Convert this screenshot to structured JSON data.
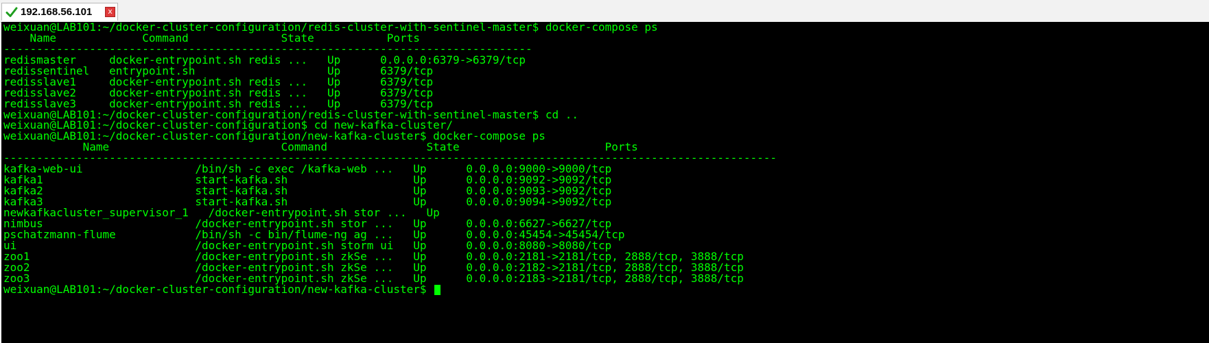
{
  "tab": {
    "title": "192.168.56.101",
    "close_label": "x",
    "status_icon": "checkmark-icon",
    "status_color": "#1e9e1e"
  },
  "terminal": {
    "text_color": "#00ff00",
    "background": "#000000",
    "lines": [
      "weixuan@LAB101:~/docker-cluster-configuration/redis-cluster-with-sentinel-master$ docker-compose ps",
      "    Name             Command              State           Ports",
      "--------------------------------------------------------------------------------",
      "redismaster     docker-entrypoint.sh redis ...   Up      0.0.0.0:6379->6379/tcp",
      "redissentinel   entrypoint.sh                    Up      6379/tcp",
      "redisslave1     docker-entrypoint.sh redis ...   Up      6379/tcp",
      "redisslave2     docker-entrypoint.sh redis ...   Up      6379/tcp",
      "redisslave3     docker-entrypoint.sh redis ...   Up      6379/tcp",
      "weixuan@LAB101:~/docker-cluster-configuration/redis-cluster-with-sentinel-master$ cd ..",
      "weixuan@LAB101:~/docker-cluster-configuration$ cd new-kafka-cluster/",
      "weixuan@LAB101:~/docker-cluster-configuration/new-kafka-cluster$ docker-compose ps",
      "            Name                          Command               State                      Ports",
      "---------------------------------------------------------------------------------------------------------------------",
      "kafka-web-ui                 /bin/sh -c exec /kafka-web ...   Up      0.0.0.0:9000->9000/tcp",
      "kafka1                       start-kafka.sh                   Up      0.0.0.0:9092->9092/tcp",
      "kafka2                       start-kafka.sh                   Up      0.0.0.0:9093->9092/tcp",
      "kafka3                       start-kafka.sh                   Up      0.0.0.0:9094->9092/tcp",
      "newkafkacluster_supervisor_1   /docker-entrypoint.sh stor ...   Up",
      "nimbus                       /docker-entrypoint.sh stor ...   Up      0.0.0.0:6627->6627/tcp",
      "pschatzmann-flume            /bin/sh -c bin/flume-ng ag ...   Up      0.0.0.0:45454->45454/tcp",
      "ui                           /docker-entrypoint.sh storm ui   Up      0.0.0.0:8080->8080/tcp",
      "zoo1                         /docker-entrypoint.sh zkSe ...   Up      0.0.0.0:2181->2181/tcp, 2888/tcp, 3888/tcp",
      "zoo2                         /docker-entrypoint.sh zkSe ...   Up      0.0.0.0:2182->2181/tcp, 2888/tcp, 3888/tcp",
      "zoo3                         /docker-entrypoint.sh zkSe ...   Up      0.0.0.0:2183->2181/tcp, 2888/tcp, 3888/tcp"
    ],
    "prompt": "weixuan@LAB101:~/docker-cluster-configuration/new-kafka-cluster$ "
  }
}
